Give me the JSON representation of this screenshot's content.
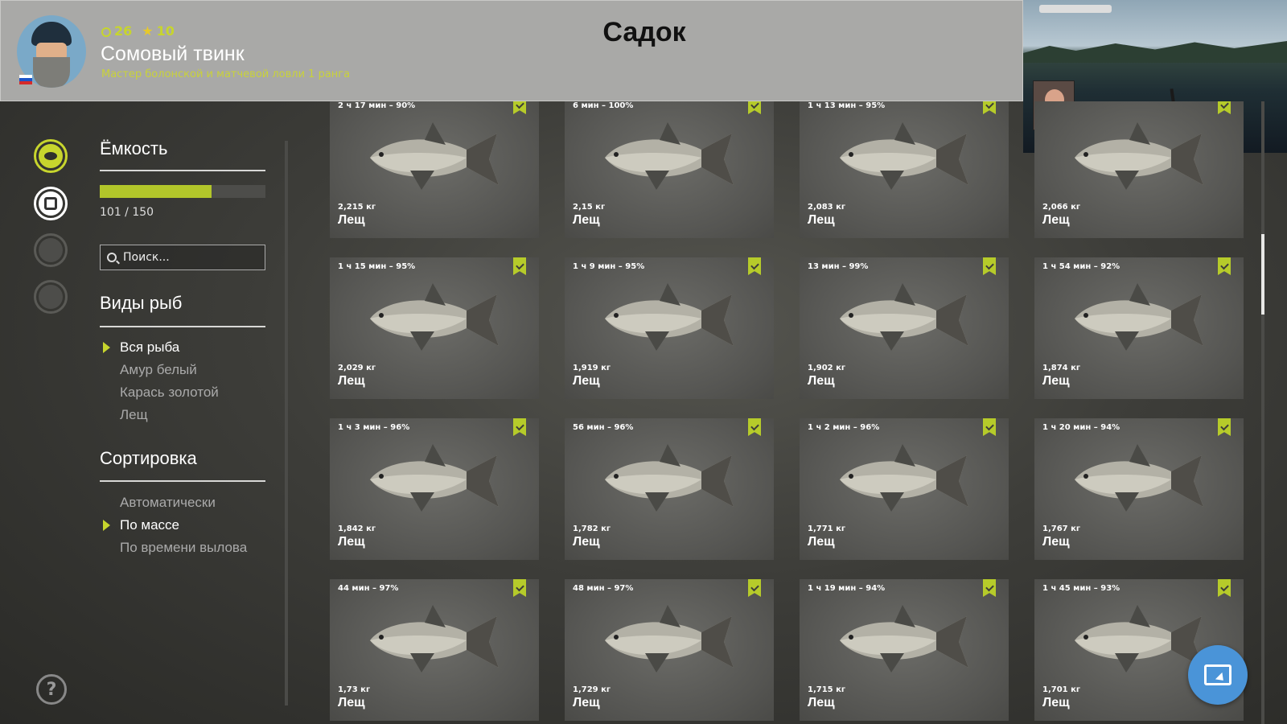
{
  "header": {
    "page_title": "Садок",
    "player": {
      "level": "26",
      "stars": "10",
      "name": "Сомовый твинк",
      "title": "Мастер болонской и матчевой ловли 1 ранга"
    }
  },
  "sidebar": {
    "nav_icons": [
      "fish-icon",
      "keepnet-icon",
      "camp-icon",
      "home-icon"
    ],
    "help_label": "?"
  },
  "capacity": {
    "title": "Ёмкость",
    "current": 101,
    "max": 150,
    "text": "101 / 150"
  },
  "search": {
    "placeholder": "Поиск..."
  },
  "species": {
    "title": "Виды рыб",
    "items": [
      {
        "label": "Вся рыба",
        "active": true
      },
      {
        "label": "Амур белый",
        "active": false
      },
      {
        "label": "Карась золотой",
        "active": false
      },
      {
        "label": "Лещ",
        "active": false
      }
    ]
  },
  "sorting": {
    "title": "Сортировка",
    "items": [
      {
        "label": "Автоматически",
        "active": false
      },
      {
        "label": "По массе",
        "active": true
      },
      {
        "label": "По времени вылова",
        "active": false
      }
    ]
  },
  "fish": [
    {
      "time": "2 ч 17 мин – 90%",
      "weight": "2,215 кг",
      "name": "Лещ"
    },
    {
      "time": "6 мин – 100%",
      "weight": "2,15 кг",
      "name": "Лещ"
    },
    {
      "time": "1 ч 13 мин – 95%",
      "weight": "2,083 кг",
      "name": "Лещ"
    },
    {
      "time": "",
      "weight": "2,066 кг",
      "name": "Лещ"
    },
    {
      "time": "1 ч 15 мин – 95%",
      "weight": "2,029 кг",
      "name": "Лещ"
    },
    {
      "time": "1 ч 9 мин – 95%",
      "weight": "1,919 кг",
      "name": "Лещ"
    },
    {
      "time": "13 мин – 99%",
      "weight": "1,902 кг",
      "name": "Лещ"
    },
    {
      "time": "1 ч 54 мин – 92%",
      "weight": "1,874 кг",
      "name": "Лещ"
    },
    {
      "time": "1 ч 3 мин – 96%",
      "weight": "1,842 кг",
      "name": "Лещ"
    },
    {
      "time": "56 мин – 96%",
      "weight": "1,782 кг",
      "name": "Лещ"
    },
    {
      "time": "1 ч 2 мин – 96%",
      "weight": "1,771 кг",
      "name": "Лещ"
    },
    {
      "time": "1 ч 20 мин – 94%",
      "weight": "1,767 кг",
      "name": "Лещ"
    },
    {
      "time": "44 мин – 97%",
      "weight": "1,73 кг",
      "name": "Лещ"
    },
    {
      "time": "48 мин – 97%",
      "weight": "1,729 кг",
      "name": "Лещ"
    },
    {
      "time": "1 ч 19 мин – 94%",
      "weight": "1,715 кг",
      "name": "Лещ"
    },
    {
      "time": "1 ч 45 мин – 93%",
      "weight": "1,701 кг",
      "name": "Лещ"
    }
  ],
  "colors": {
    "accent": "#c7d52d",
    "header_bg": "#a9a9a7",
    "card_bg": "#555552",
    "cursor_button": "#4a94d8"
  }
}
